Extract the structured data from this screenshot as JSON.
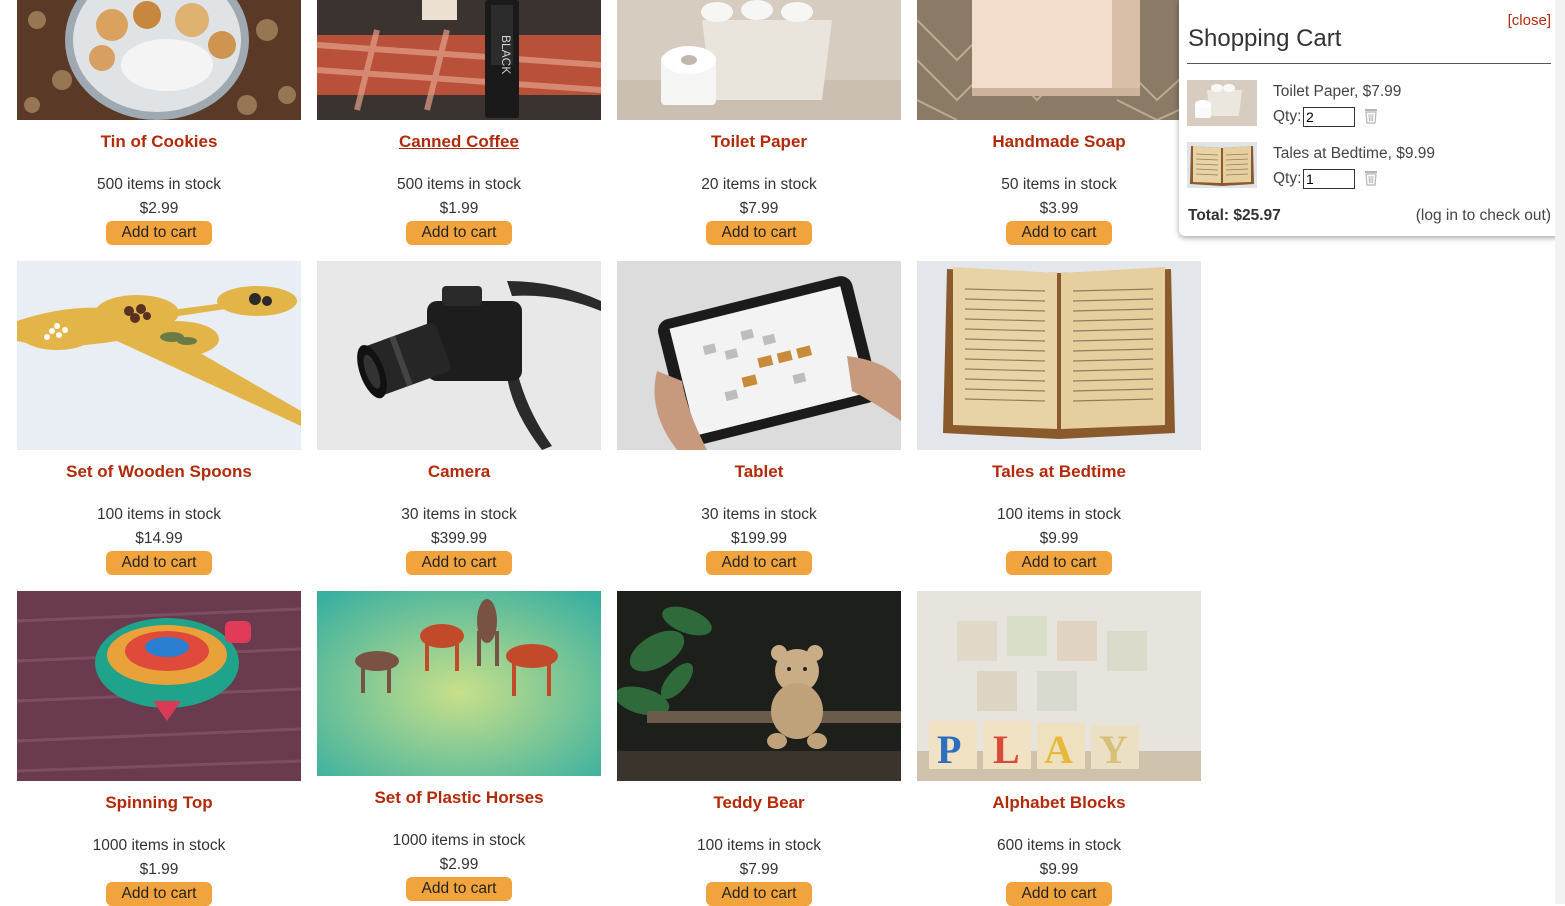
{
  "products": [
    {
      "name": "Tin of Cookies",
      "stock": "500 items in stock",
      "price": "$2.99",
      "button": "Add to cart",
      "image": "cookie-tin-photo"
    },
    {
      "name": "Canned Coffee",
      "stock": "500 items in stock",
      "price": "$1.99",
      "button": "Add to cart",
      "image": "canned-coffee-photo"
    },
    {
      "name": "Toilet Paper",
      "stock": "20 items in stock",
      "price": "$7.99",
      "button": "Add to cart",
      "image": "toilet-paper-photo"
    },
    {
      "name": "Handmade Soap",
      "stock": "50 items in stock",
      "price": "$3.99",
      "button": "Add to cart",
      "image": "soap-photo"
    },
    {
      "name": "Set of Wooden Spoons",
      "stock": "100 items in stock",
      "price": "$14.99",
      "button": "Add to cart",
      "image": "wooden-spoons-photo"
    },
    {
      "name": "Camera",
      "stock": "30 items in stock",
      "price": "$399.99",
      "button": "Add to cart",
      "image": "camera-photo"
    },
    {
      "name": "Tablet",
      "stock": "30 items in stock",
      "price": "$199.99",
      "button": "Add to cart",
      "image": "tablet-photo"
    },
    {
      "name": "Tales at Bedtime",
      "stock": "100 items in stock",
      "price": "$9.99",
      "button": "Add to cart",
      "image": "book-photo"
    },
    {
      "name": "Spinning Top",
      "stock": "1000 items in stock",
      "price": "$1.99",
      "button": "Add to cart",
      "image": "spinning-top-photo"
    },
    {
      "name": "Set of Plastic Horses",
      "stock": "1000 items in stock",
      "price": "$2.99",
      "button": "Add to cart",
      "image": "plastic-horses-photo"
    },
    {
      "name": "Teddy Bear",
      "stock": "100 items in stock",
      "price": "$7.99",
      "button": "Add to cart",
      "image": "teddy-bear-photo"
    },
    {
      "name": "Alphabet Blocks",
      "stock": "600 items in stock",
      "price": "$9.99",
      "button": "Add to cart",
      "image": "alphabet-blocks-photo"
    }
  ],
  "cart": {
    "close_label": "[close]",
    "title": "Shopping Cart",
    "items": [
      {
        "line": "Toilet Paper, $7.99",
        "qty_label": "Qty:",
        "qty": "2",
        "image": "toilet-paper-photo"
      },
      {
        "line": "Tales at Bedtime, $9.99",
        "qty_label": "Qty:",
        "qty": "1",
        "image": "book-photo"
      }
    ],
    "total": "Total: $25.97",
    "checkout_note": "(log in to check out)"
  },
  "colors": {
    "accent": "#b22a0a",
    "button": "#f1a43d"
  }
}
